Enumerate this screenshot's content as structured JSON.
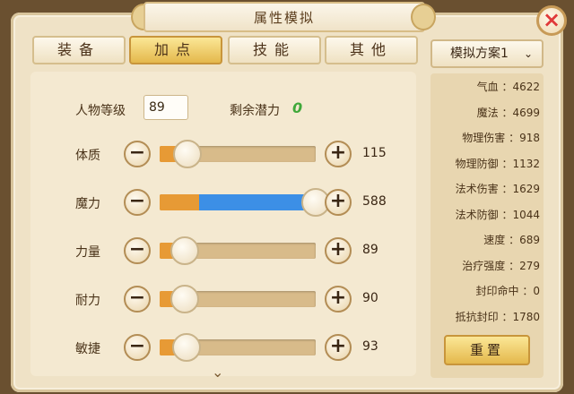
{
  "window": {
    "title": "属性模拟",
    "close_icon": "×"
  },
  "tabs": [
    {
      "label": "装备",
      "active": false
    },
    {
      "label": "加点",
      "active": true
    },
    {
      "label": "技能",
      "active": false
    },
    {
      "label": "其他",
      "active": false
    }
  ],
  "level": {
    "label": "人物等级",
    "value": "89"
  },
  "potential": {
    "label": "剩余潜力",
    "value": "0"
  },
  "attributes": [
    {
      "label": "体质",
      "value": "115",
      "base_fraction": 0.18,
      "added_fraction": 0.0
    },
    {
      "label": "魔力",
      "value": "588",
      "base_fraction": 0.25,
      "added_fraction": 0.75
    },
    {
      "label": "力量",
      "value": "89",
      "base_fraction": 0.16,
      "added_fraction": 0.0
    },
    {
      "label": "耐力",
      "value": "90",
      "base_fraction": 0.16,
      "added_fraction": 0.0
    },
    {
      "label": "敏捷",
      "value": "93",
      "base_fraction": 0.17,
      "added_fraction": 0.0
    }
  ],
  "controls": {
    "minus_symbol": "−",
    "plus_symbol": "+",
    "scroll_down_symbol": "⌄"
  },
  "plan_selector": {
    "label": "模拟方案1",
    "chevron": "⌄"
  },
  "stats": [
    {
      "text": "气血 ：4622"
    },
    {
      "text": "魔法 ：4699"
    },
    {
      "text": "物理伤害 ：918"
    },
    {
      "text": "物理防御 ：1132"
    },
    {
      "text": "法术伤害 ：1629"
    },
    {
      "text": "法术防御 ：1044"
    },
    {
      "text": "速度 ：689"
    },
    {
      "text": "治疗强度 ：279"
    },
    {
      "text": "封印命中 ：0"
    },
    {
      "text": "抵抗封印 ：1780"
    }
  ],
  "reset_button": {
    "label": "重置"
  },
  "colors": {
    "base_fill": "#e79a35",
    "added_fill": "#3c8fe6",
    "potential": "#3fa83a"
  }
}
